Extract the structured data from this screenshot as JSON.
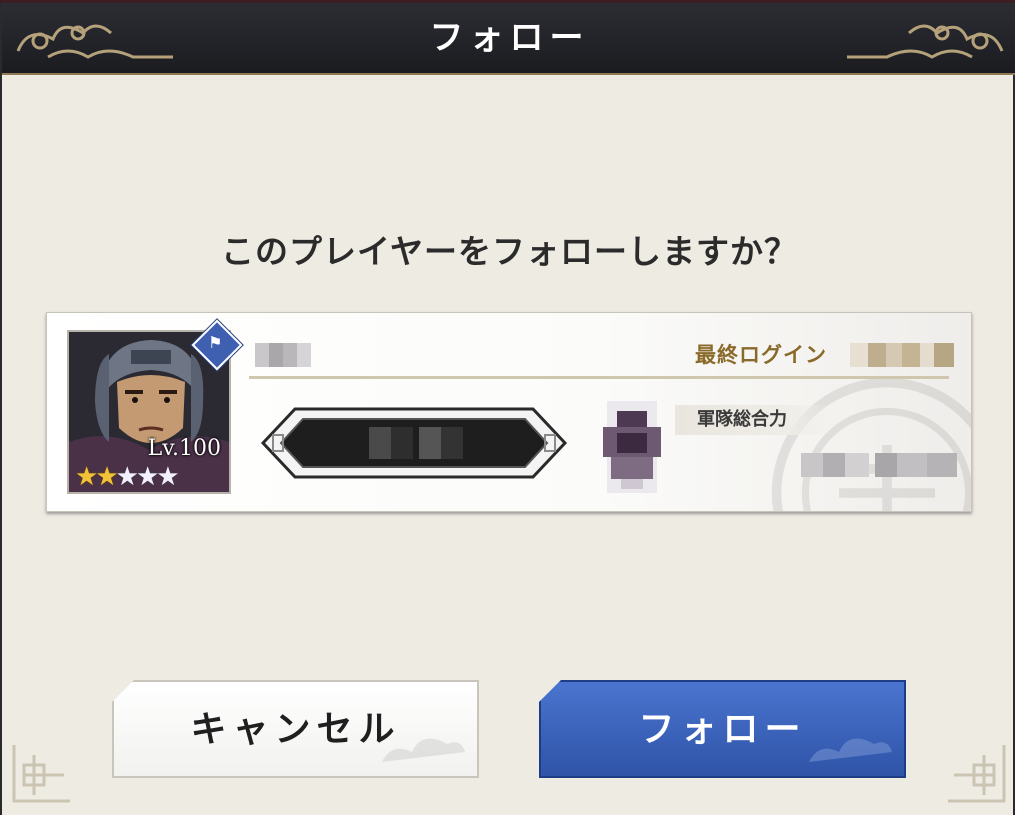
{
  "dialog": {
    "title": "フォロー",
    "question": "このプレイヤーをフォローしますか？"
  },
  "player_card": {
    "level": "Lv.100",
    "stars_filled": 2,
    "stars_total": 5,
    "last_login_label": "最終ログイン",
    "army_power_label": "軍隊総合力"
  },
  "buttons": {
    "cancel_label": "キャンセル",
    "follow_label": "フォロー"
  },
  "colors": {
    "accent_gold": "#8a6a2a",
    "follow_blue": "#3a62bd",
    "title_bar": "#24252a"
  }
}
